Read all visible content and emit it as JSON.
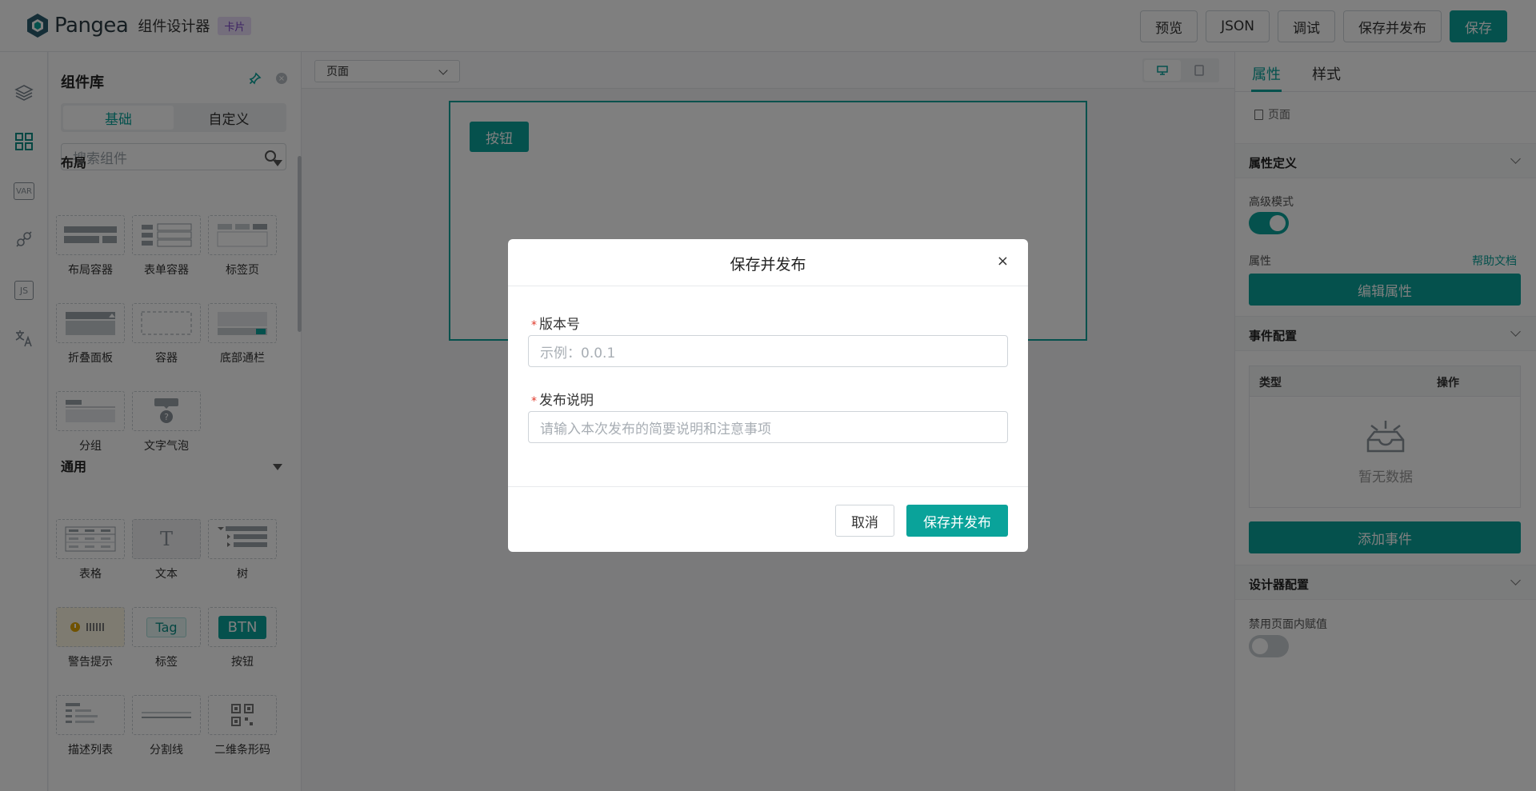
{
  "header": {
    "logo_text": "Pangea",
    "app_title": "组件设计器",
    "badge": "卡片",
    "actions": [
      "预览",
      "JSON",
      "调试",
      "保存并发布",
      "保存"
    ]
  },
  "rail": {
    "icons": [
      "layers-icon",
      "grid-icon",
      "var-icon",
      "plug-icon",
      "js-icon",
      "translate-icon"
    ],
    "var_text": "VAR",
    "js_text": "JS"
  },
  "library": {
    "title": "组件库",
    "tabs": [
      "基础",
      "自定义"
    ],
    "search_placeholder": "搜索组件",
    "sections": [
      {
        "title": "布局",
        "items": [
          "布局容器",
          "表单容器",
          "标签页",
          "折叠面板",
          "容器",
          "底部通栏",
          "分组",
          "文字气泡"
        ]
      },
      {
        "title": "通用",
        "items": [
          "表格",
          "文本",
          "树",
          "警告提示",
          "标签",
          "按钮",
          "描述列表",
          "分割线",
          "二维条形码"
        ]
      }
    ],
    "thumb_text": {
      "text_t": "T",
      "tag": "Tag",
      "btn": "BTN",
      "help": "?"
    }
  },
  "canvas": {
    "page_select": "页面",
    "card_button": "按钮"
  },
  "props": {
    "tabs": [
      "属性",
      "样式"
    ],
    "breadcrumb": "页面",
    "section_attr_def": "属性定义",
    "advanced_mode": "高级模式",
    "attr_label": "属性",
    "help_doc": "帮助文档",
    "edit_attr": "编辑属性",
    "section_events": "事件配置",
    "event_cols": [
      "类型",
      "操作"
    ],
    "empty_text": "暂无数据",
    "add_event": "添加事件",
    "section_designer": "设计器配置",
    "disable_assign": "禁用页面内赋值"
  },
  "modal": {
    "title": "保存并发布",
    "version_label": "版本号",
    "version_placeholder": "示例：0.0.1",
    "desc_label": "发布说明",
    "desc_placeholder": "请输入本次发布的简要说明和注意事项",
    "cancel": "取消",
    "confirm": "保存并发布"
  },
  "colors": {
    "primary": "#0aa39a",
    "badge_bg": "#e9dcf8",
    "required": "#e0392b"
  }
}
